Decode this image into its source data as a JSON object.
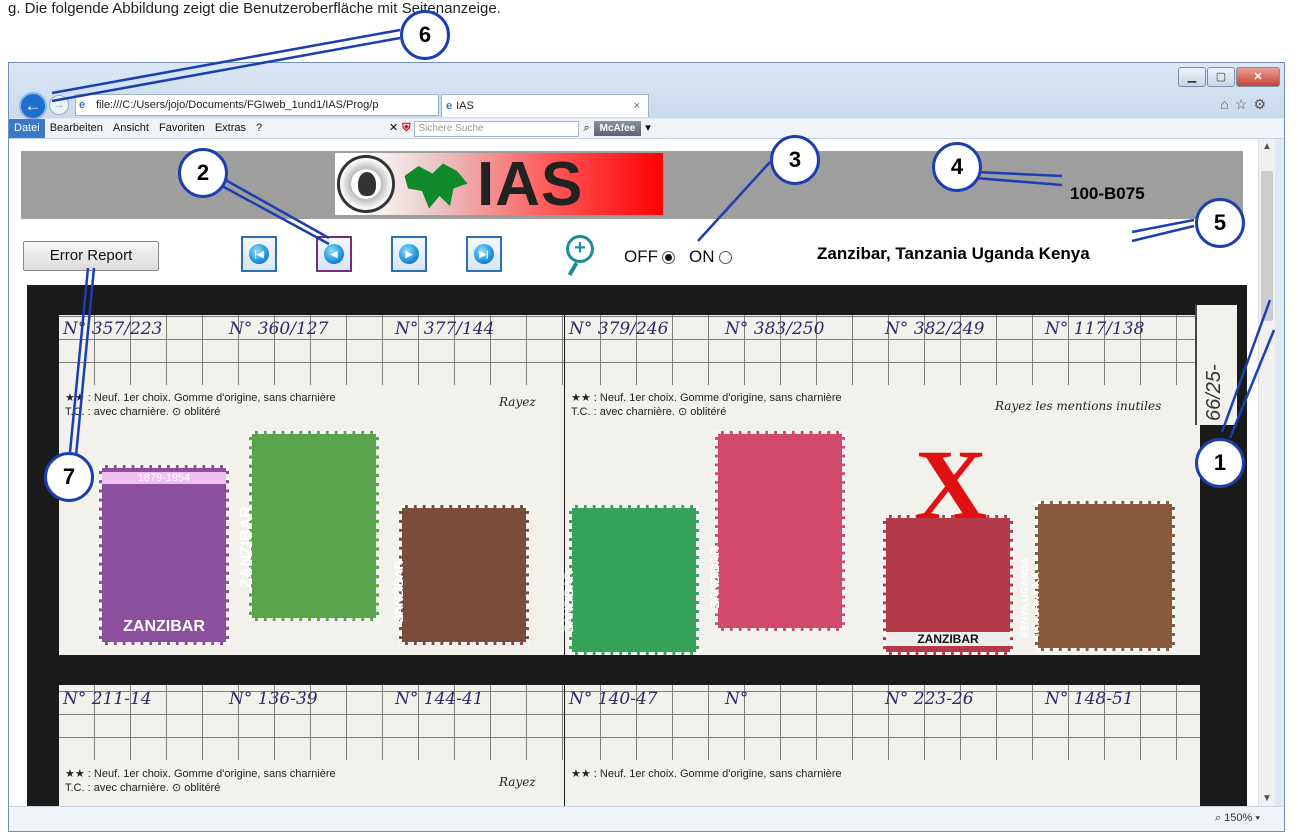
{
  "caption": "g. Die folgende Abbildung zeigt die Benutzeroberfläche mit Seitenanzeige.",
  "browser": {
    "address": "file:///C:/Users/jojo/Documents/FGIweb_1und1/IAS/Prog/p",
    "tab_title": "IAS",
    "menu": [
      "Datei",
      "Bearbeiten",
      "Ansicht",
      "Favoriten",
      "Extras",
      "?"
    ],
    "search_placeholder": "Sichere Suche",
    "mcafee_label": "McAfee",
    "zoom": "150%"
  },
  "page": {
    "logo_text": "IAS",
    "item_code": "100-B075",
    "error_button": "Error Report",
    "radio_off": "OFF",
    "radio_on": "ON",
    "radio_selected": "OFF",
    "region": "Zanzibar, Tanzania Uganda Kenya"
  },
  "album": {
    "top_left_entries": [
      "N° 357/223",
      "N° 360/127",
      "N° 377/144"
    ],
    "top_right_entries": [
      "N° 379/246",
      "N° 383/250",
      "N° 382/249",
      "N° 117/138"
    ],
    "bottom_left_entries": [
      "N° 211-14",
      "N° 136-39",
      "N° 144-41"
    ],
    "bottom_right_entries": [
      "N° 140-47",
      "N°",
      "N° 223-26",
      "N° 148-51"
    ],
    "rules_line1": "★★ : Neuf. 1er choix. Gomme d'origine, sans charnière",
    "rules_line2": "T.C. : avec charnière.   ⊙ oblitéré",
    "rayez_left": "Rayez",
    "rayez_right": "Rayez les mentions inutiles",
    "strip_text": "66/25-",
    "stamp_labels": [
      "ZANZIBAR",
      "ZANZIBAR",
      "ZANZIBAR",
      "ZANZIBAR",
      "ZANZIBAR",
      "ZANZIBAR",
      "KENYA UGANDA TANGANYIKA"
    ],
    "stamp_banner": "1879-1954",
    "cross": "X"
  },
  "callouts": [
    "1",
    "2",
    "3",
    "4",
    "5",
    "6",
    "7"
  ]
}
